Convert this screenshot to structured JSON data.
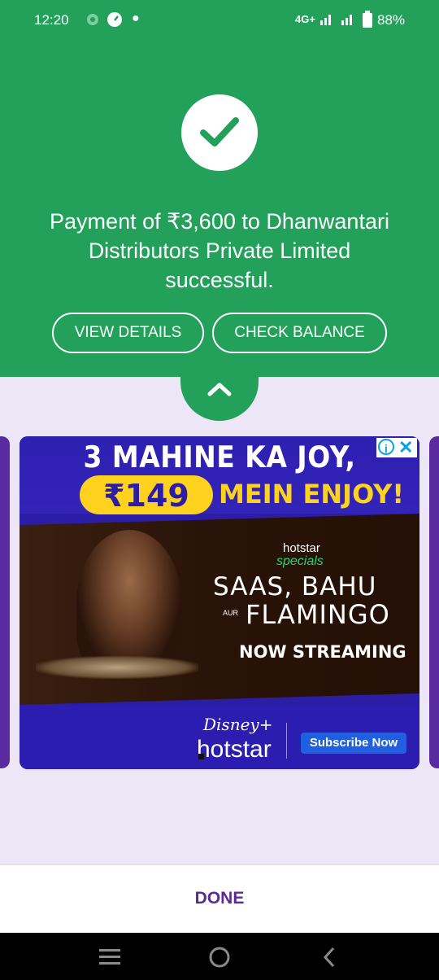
{
  "status_bar": {
    "time": "12:20",
    "network": "4G+",
    "battery": "88%"
  },
  "payment": {
    "message": "Payment of ₹3,600 to Dhanwantari Distributors Private Limited successful.",
    "view_details_label": "VIEW DETAILS",
    "check_balance_label": "CHECK BALANCE"
  },
  "ad": {
    "headline": "3 MAHINE KA JOY,",
    "price": "₹149",
    "tagline": "MEIN ENJOY!",
    "brand_top": "hotstar",
    "brand_sub": "specials",
    "show_title_1": "SAAS, BAHU",
    "show_title_aur": "AUR",
    "show_title_2": "FLAMINGO",
    "streaming": "NOW STREAMING",
    "logo_disney": "Disney+",
    "logo_hotstar": "hotstar",
    "cta": "Subscribe Now"
  },
  "footer": {
    "done_label": "DONE"
  },
  "colors": {
    "primary_green": "#23a05a",
    "sheet_bg": "#ece6f6",
    "done_purple": "#5b2a95",
    "ad_blue": "#2b1da6",
    "ad_yellow": "#ffd21f"
  }
}
